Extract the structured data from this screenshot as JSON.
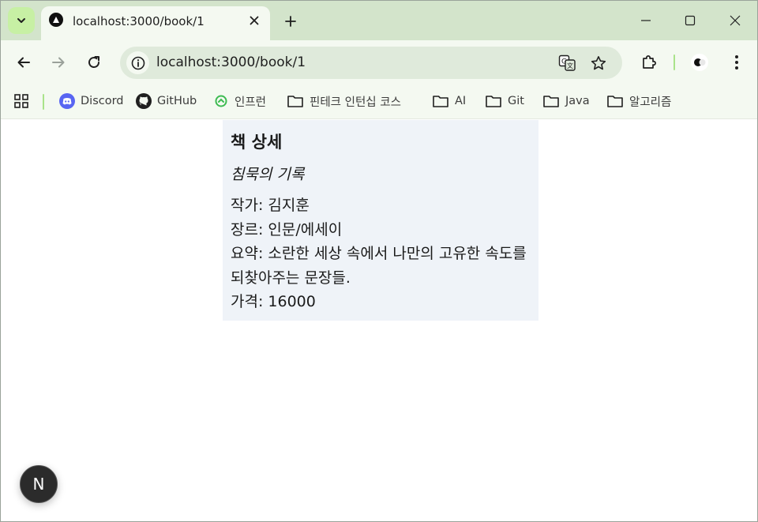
{
  "browser": {
    "tab": {
      "title": "localhost:3000/book/1"
    },
    "address": {
      "url": "localhost:3000/book/1"
    },
    "bookmarks": [
      {
        "label": "Discord",
        "icon": "discord-icon"
      },
      {
        "label": "GitHub",
        "icon": "github-icon"
      },
      {
        "label": "인프런",
        "icon": "inflearn-icon"
      },
      {
        "label": "핀테크 인턴십 코스",
        "icon": "folder-icon"
      },
      {
        "label": "AI",
        "icon": "folder-icon"
      },
      {
        "label": "Git",
        "icon": "folder-icon"
      },
      {
        "label": "Java",
        "icon": "folder-icon"
      },
      {
        "label": "알고리즘",
        "icon": "folder-icon"
      }
    ],
    "colors": {
      "tabstrip": "#d3e4cb",
      "toolbar": "#f4f9f1",
      "omnibox": "#dfeadb"
    }
  },
  "book": {
    "heading": "책 상세",
    "title": "침묵의 기록",
    "author_line": "작가: 김지훈",
    "genre_line": "장르: 인문/에세이",
    "summary_line": "요약: 소란한 세상 속에서 나만의 고유한 속도를 되찾아주는 문장들.",
    "price_line": "가격: 16000"
  },
  "devtools": {
    "badge_letter": "N"
  }
}
